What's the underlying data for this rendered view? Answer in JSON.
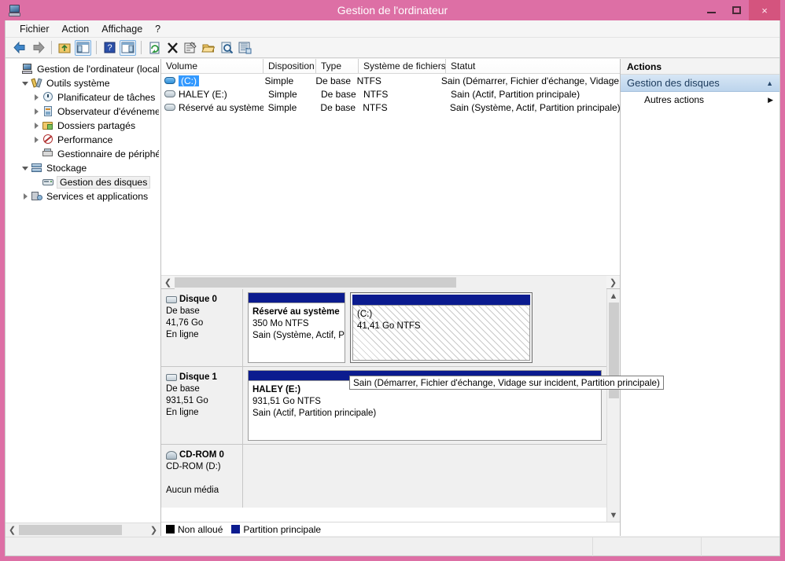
{
  "window": {
    "title": "Gestion de l'ordinateur",
    "icon": "computer-management-icon",
    "frame_color": "#dd6fa5",
    "close_color": "#d4547e",
    "controls": {
      "minimize": "minimize-icon",
      "maximize": "maximize-icon",
      "close": "×"
    }
  },
  "menu": {
    "items": [
      "Fichier",
      "Action",
      "Affichage",
      "?"
    ]
  },
  "toolbar": {
    "icons": [
      "back-arrow-icon",
      "forward-arrow-icon",
      "up-folder-icon",
      "show-console-tree-icon",
      "help-icon",
      "show-action-pane-icon",
      "refresh-icon",
      "delete-icon",
      "properties-icon",
      "open-icon",
      "search-icon",
      "export-list-icon"
    ]
  },
  "tree": {
    "items": [
      {
        "label": "Gestion de l'ordinateur (local)",
        "icon": "computer-icon",
        "indent": 0,
        "expander": "none",
        "selected": false
      },
      {
        "label": "Outils système",
        "icon": "tools-icon",
        "indent": 1,
        "expander": "open",
        "selected": false
      },
      {
        "label": "Planificateur de tâches",
        "icon": "clock-icon",
        "indent": 2,
        "expander": "closed",
        "selected": false
      },
      {
        "label": "Observateur d'événements",
        "icon": "event-viewer-icon",
        "indent": 2,
        "expander": "closed",
        "selected": false
      },
      {
        "label": "Dossiers partagés",
        "icon": "shared-folder-icon",
        "indent": 2,
        "expander": "closed",
        "selected": false
      },
      {
        "label": "Performance",
        "icon": "performance-icon",
        "indent": 2,
        "expander": "closed",
        "selected": false
      },
      {
        "label": "Gestionnaire de périphériques",
        "icon": "device-manager-icon",
        "indent": 2,
        "expander": "none",
        "selected": false
      },
      {
        "label": "Stockage",
        "icon": "storage-icon",
        "indent": 1,
        "expander": "open",
        "selected": false
      },
      {
        "label": "Gestion des disques",
        "icon": "disk-management-icon",
        "indent": 2,
        "expander": "none",
        "selected": true
      },
      {
        "label": "Services et applications",
        "icon": "services-icon",
        "indent": 1,
        "expander": "closed",
        "selected": false
      }
    ]
  },
  "volume_list": {
    "columns": [
      "Volume",
      "Disposition",
      "Type",
      "Système de fichiers",
      "Statut"
    ],
    "rows": [
      {
        "volume": "(C:)",
        "disposition": "Simple",
        "type": "De base",
        "filesystem": "NTFS",
        "status": "Sain (Démarrer, Fichier d'échange, Vidage s",
        "selected": true
      },
      {
        "volume": "HALEY (E:)",
        "disposition": "Simple",
        "type": "De base",
        "filesystem": "NTFS",
        "status": "Sain (Actif, Partition principale)",
        "selected": false
      },
      {
        "volume": "Réservé au système",
        "disposition": "Simple",
        "type": "De base",
        "filesystem": "NTFS",
        "status": "Sain (Système, Actif, Partition principale)",
        "selected": false
      }
    ]
  },
  "disks": [
    {
      "name": "Disque 0",
      "icon": "disk-icon",
      "type": "De base",
      "size": "41,76 Go",
      "state": "En ligne",
      "partitions": [
        {
          "name": "Réservé au système",
          "size": "350 Mo NTFS",
          "status": "Sain (Système, Actif, P",
          "selected": false,
          "width_pct": 27
        },
        {
          "name": "(C:)",
          "size": "41,41 Go NTFS",
          "status": "Sain (Démarrer, Fichier d'échange, Vidage sur incident, Partition principale)",
          "selected": true,
          "width_pct": 48
        }
      ]
    },
    {
      "name": "Disque 1",
      "icon": "disk-icon",
      "type": "De base",
      "size": "931,51 Go",
      "state": "En ligne",
      "partitions": [
        {
          "name": "HALEY  (E:)",
          "size": "931,51 Go NTFS",
          "status": "Sain (Actif, Partition principale)",
          "selected": false,
          "width_pct": 100
        }
      ]
    },
    {
      "name": "CD-ROM 0",
      "icon": "cdrom-icon",
      "type": "CD-ROM (D:)",
      "size": "",
      "state": "Aucun média",
      "partitions": []
    }
  ],
  "legend": [
    {
      "label": "Non alloué",
      "color": "#000000"
    },
    {
      "label": "Partition principale",
      "color": "#0b1b8f"
    }
  ],
  "tooltip": {
    "text": "Sain (Démarrer, Fichier d'échange, Vidage sur incident, Partition principale)"
  },
  "actions": {
    "title": "Actions",
    "group": {
      "label": "Gestion des disques",
      "chevron": "chevron-up-icon"
    },
    "items": [
      {
        "label": "Autres actions",
        "chevron": "chevron-right-icon"
      }
    ]
  },
  "scrollbars": {
    "tree_h": "horizontal-scrollbar",
    "list_h": "horizontal-scrollbar",
    "graph_v": "vertical-scrollbar"
  }
}
